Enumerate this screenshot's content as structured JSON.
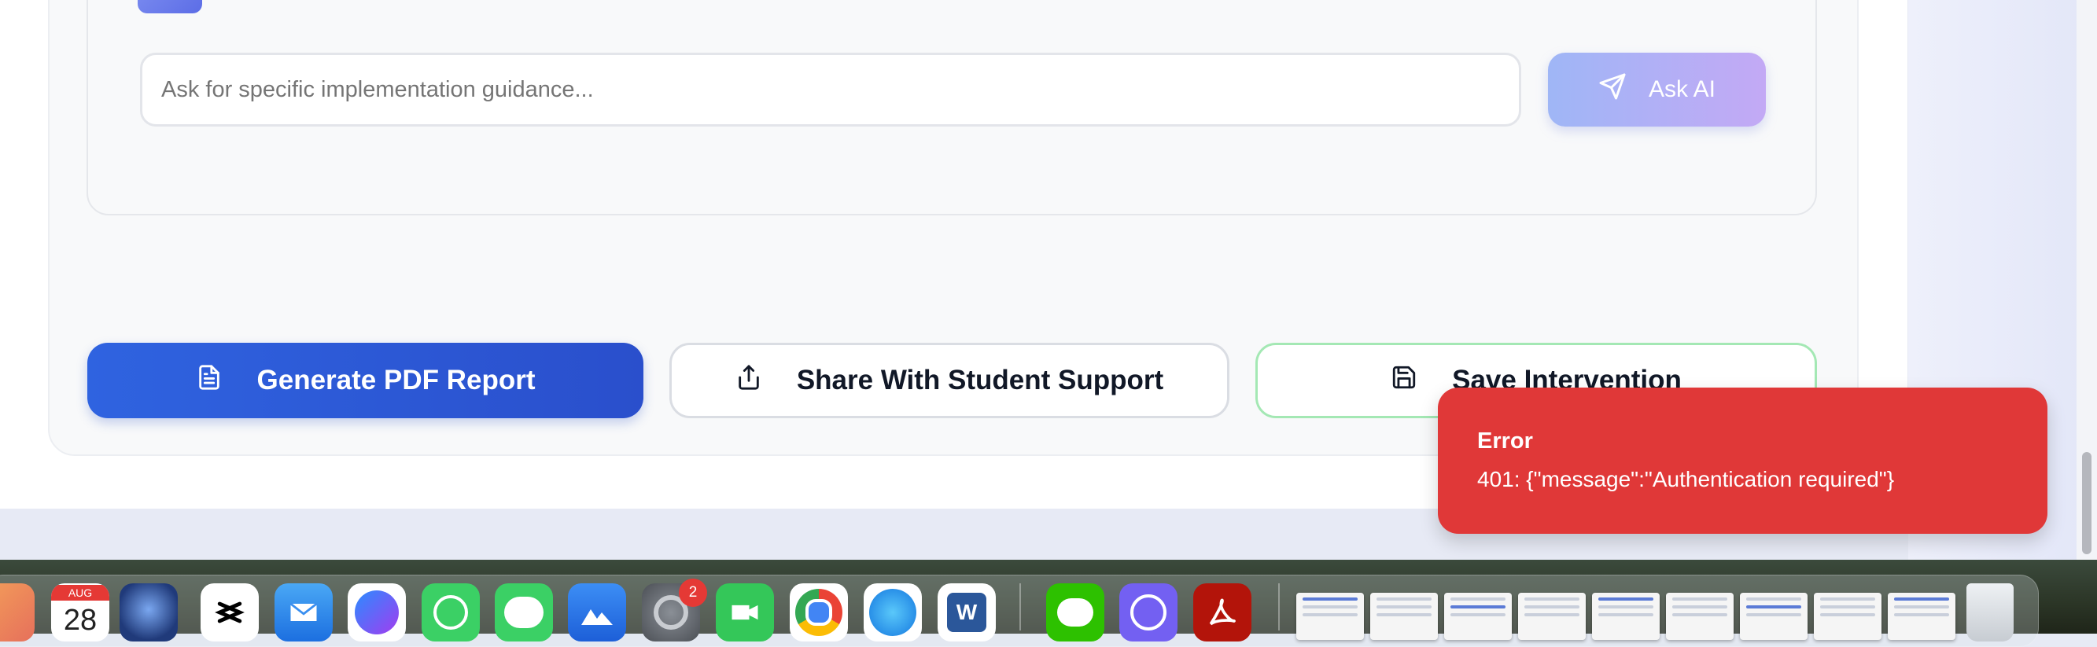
{
  "ai_panel": {
    "input_placeholder": "Ask for specific implementation guidance...",
    "ask_button_label": "Ask AI"
  },
  "actions": {
    "generate_pdf_label": "Generate PDF Report",
    "share_label": "Share With Student Support",
    "save_label": "Save Intervention"
  },
  "toast": {
    "title": "Error",
    "message": "401: {\"message\":\"Authentication required\"}"
  },
  "dock": {
    "calendar_month": "AUG",
    "calendar_day": "28",
    "settings_badge": "2",
    "word_letter": "W",
    "apps": [
      "launchpad-icon",
      "calendar-icon",
      "brain-app-icon",
      "capcut-icon",
      "mail-icon",
      "messenger-icon",
      "whatsapp-icon",
      "messages-icon",
      "app-icon",
      "system-settings-icon",
      "facetime-icon",
      "chrome-icon",
      "safari-icon",
      "word-icon",
      "wechat-icon",
      "viber-icon",
      "acrobat-icon",
      "trash-icon"
    ]
  },
  "colors": {
    "primary_blue": "#2f63e0",
    "error_red": "#e03838",
    "save_border_green": "#a4e8b4",
    "ask_gradient_start": "#9fb6f6",
    "ask_gradient_end": "#c3a9f5"
  }
}
